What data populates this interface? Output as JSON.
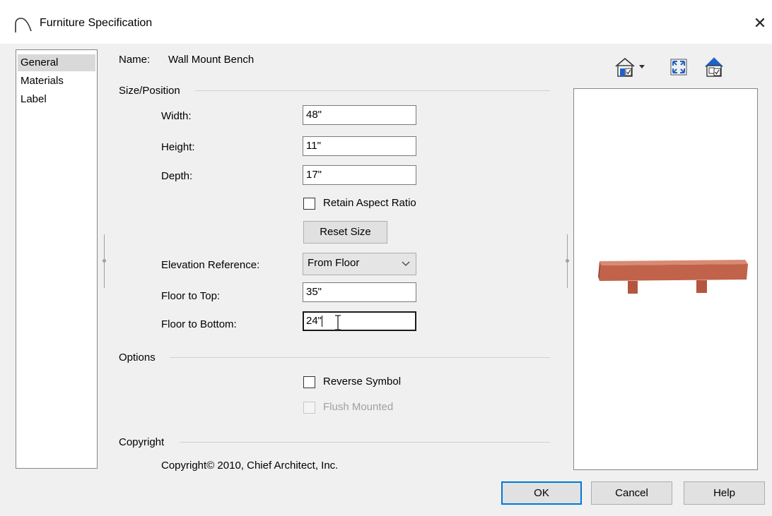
{
  "window": {
    "title": "Furniture Specification",
    "close_glyph": "✕"
  },
  "sidebar": {
    "items": [
      {
        "label": "General",
        "selected": true
      },
      {
        "label": "Materials",
        "selected": false
      },
      {
        "label": "Label",
        "selected": false
      }
    ]
  },
  "general": {
    "name_label": "Name:",
    "name_value": "Wall Mount Bench",
    "size_group": "Size/Position",
    "width_label": "Width:",
    "width_value": "48\"",
    "height_label": "Height:",
    "height_value": "11\"",
    "depth_label": "Depth:",
    "depth_value": "17\"",
    "retain_label": "Retain Aspect Ratio",
    "retain_checked": false,
    "reset_label": "Reset Size",
    "elevation_label": "Elevation Reference:",
    "elevation_value": "From Floor",
    "floor_top_label": "Floor to Top:",
    "floor_top_value": "35\"",
    "floor_bottom_label": "Floor to Bottom:",
    "floor_bottom_value": "24\"",
    "options_group": "Options",
    "reverse_label": "Reverse Symbol",
    "reverse_checked": false,
    "flush_label": "Flush Mounted",
    "flush_checked": false,
    "flush_enabled": false,
    "copyright_group": "Copyright",
    "copyright_text": "Copyright© 2010, Chief Architect, Inc."
  },
  "preview_toolbar": {
    "icons": [
      "camera-view-icon",
      "fill-window-icon",
      "display-options-icon"
    ]
  },
  "preview": {
    "object_color": "#c0634a"
  },
  "footer": {
    "ok_label": "OK",
    "cancel_label": "Cancel",
    "help_label": "Help"
  }
}
